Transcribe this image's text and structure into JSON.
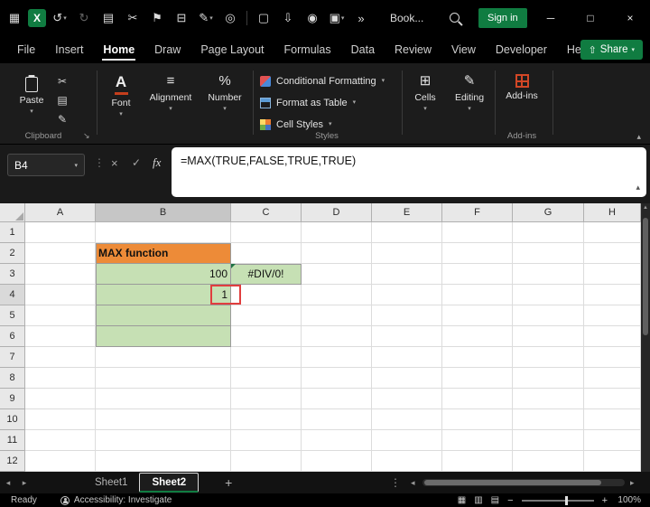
{
  "theme": {
    "accent_green": "#107C41",
    "highlight_red": "#E03E3E"
  },
  "title_bar": {
    "qat_icons": [
      "app-launcher",
      "excel-logo",
      "undo",
      "redo",
      "paste-special",
      "cut",
      "flag",
      "print",
      "draw",
      "ink",
      "divider",
      "new-file",
      "save",
      "camera",
      "picture",
      "more-commands"
    ],
    "workbook_name": "Book...",
    "sign_in": "Sign in",
    "window_controls": [
      "minimize",
      "maximize",
      "close"
    ]
  },
  "menu": {
    "tabs": [
      "File",
      "Insert",
      "Home",
      "Draw",
      "Page Layout",
      "Formulas",
      "Data",
      "Review",
      "View",
      "Developer",
      "Help"
    ],
    "active_tab": "Home",
    "share": "Share"
  },
  "ribbon": {
    "paste": "Paste",
    "clipboard_group": "Clipboard",
    "font": "Font",
    "alignment": "Alignment",
    "number": "Number",
    "conditional_formatting": "Conditional Formatting",
    "format_as_table": "Format as Table",
    "cell_styles": "Cell Styles",
    "styles_group": "Styles",
    "cells": "Cells",
    "editing": "Editing",
    "addins": "Add-ins",
    "addins_group": "Add-ins"
  },
  "formula_bar": {
    "name_box": "B4",
    "fx_label": "fx",
    "formula": "=MAX(TRUE,FALSE,TRUE,TRUE)"
  },
  "grid": {
    "column_headers": [
      "A",
      "B",
      "C",
      "D",
      "E",
      "F",
      "G",
      "H"
    ],
    "row_headers": [
      "1",
      "2",
      "3",
      "4",
      "5",
      "6",
      "7",
      "8",
      "9",
      "10",
      "11",
      "12"
    ],
    "selected_column": "B",
    "selected_row": "4",
    "colors": {
      "orange_fill": "#ED8B38",
      "green_fill": "#C6E0B4"
    },
    "cells": [
      {
        "ref": "B2",
        "text": "MAX function",
        "fill": "orange",
        "bold": true,
        "align": "left"
      },
      {
        "ref": "B3",
        "text": "100",
        "fill": "green",
        "align": "right"
      },
      {
        "ref": "C3",
        "text": "#DIV/0!",
        "fill": "green",
        "align": "center",
        "error": true
      },
      {
        "ref": "B4",
        "text": "1",
        "fill": "green",
        "align": "right",
        "annotated": true
      },
      {
        "ref": "B5",
        "text": "",
        "fill": "green"
      },
      {
        "ref": "B6",
        "text": "",
        "fill": "green"
      }
    ]
  },
  "sheet_bar": {
    "tabs": [
      "Sheet1",
      "Sheet2"
    ],
    "active_tab": "Sheet2",
    "add_sheet": "+"
  },
  "status_bar": {
    "mode": "Ready",
    "accessibility": "Accessibility: Investigate",
    "view_icons": [
      "normal-view",
      "page-layout-view",
      "page-break-view"
    ],
    "zoom": "100%"
  }
}
